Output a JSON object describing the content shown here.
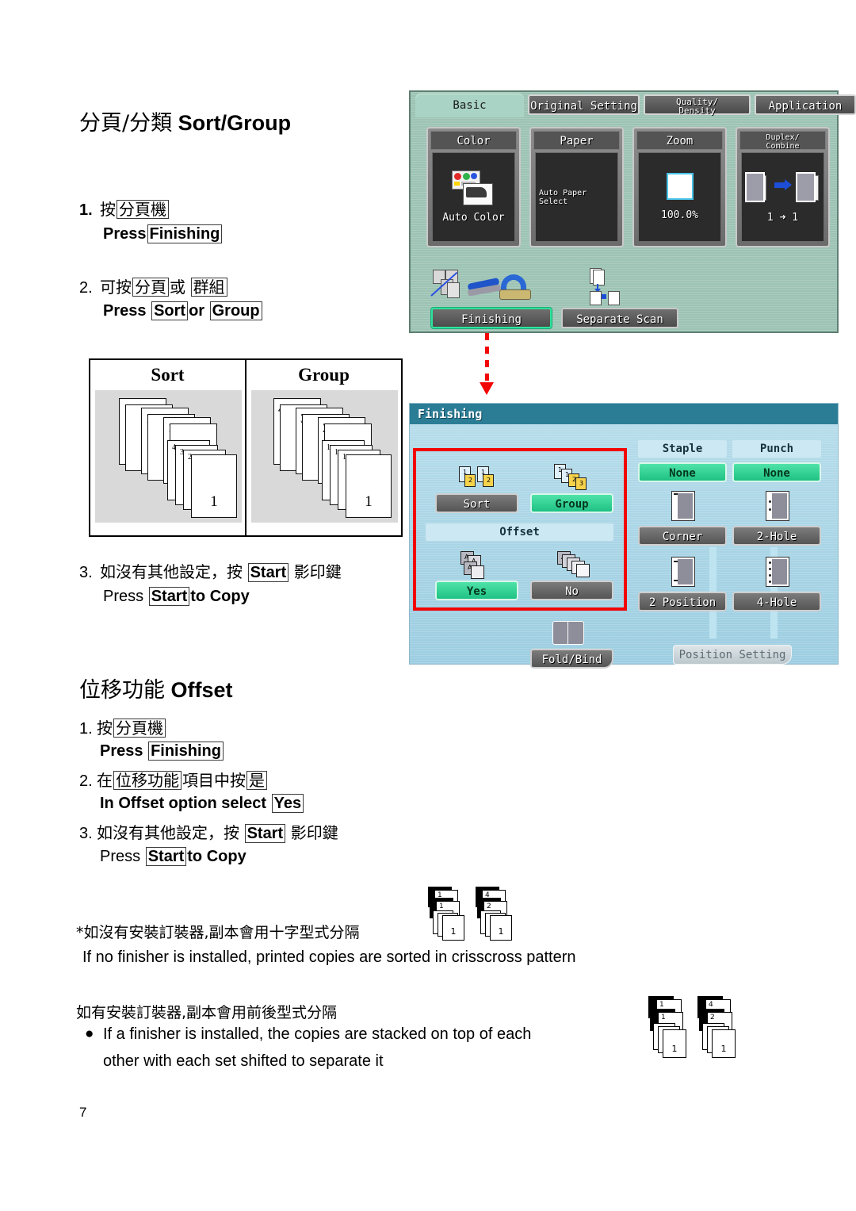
{
  "document": {
    "page_number": "7"
  },
  "section1": {
    "heading_cjk": "分頁/分類",
    "heading_en": "Sort/Group",
    "steps": [
      {
        "num": "1.",
        "cjk_prefix": "按",
        "cjk_box": "分頁機",
        "cjk_suffix": "",
        "en_prefix": "Press",
        "en_box1": "Finishing",
        "en_mid": "",
        "en_box2": "",
        "en_suffix": ""
      },
      {
        "num": "2.",
        "cjk_prefix": "可按",
        "cjk_box": "分頁",
        "cjk_mid": "或",
        "cjk_box2": "群組",
        "en_prefix": "Press",
        "en_box1": "Sort",
        "en_mid": "or",
        "en_box2": "Group",
        "en_suffix": ""
      },
      {
        "num": "3.",
        "cjk_prefix": "如沒有其他設定，按",
        "cjk_box": "Start",
        "cjk_suffix": "影印鍵",
        "en_prefix": "Press",
        "en_box1": "Start",
        "en_suffix": "to Copy"
      }
    ]
  },
  "figure": {
    "sort_caption": "Sort",
    "group_caption": "Group",
    "sort_labels_back": [
      "1",
      "1",
      "1"
    ],
    "sort_labels_front_small": [
      "4",
      "3",
      "2"
    ],
    "sort_label_front": "1",
    "group_labels_back": [
      "4",
      "3",
      "2"
    ],
    "group_labels_front_small": [
      "1",
      "1",
      "1"
    ],
    "group_label_front": "1"
  },
  "section2": {
    "heading_cjk": "位移功能",
    "heading_en": "Offset",
    "steps": [
      {
        "num": "1.",
        "cjk_prefix": "按",
        "cjk_box": "分頁機",
        "en_prefix": "Press",
        "en_box1": "Finishing"
      },
      {
        "num": "2.",
        "cjk_prefix": "在",
        "cjk_box": "位移功能",
        "cjk_mid": "項目中按",
        "cjk_box2": "是",
        "en_prefix": "In Offset option select",
        "en_box1": "Yes"
      },
      {
        "num": "3.",
        "cjk_prefix": "如沒有其他設定，按",
        "cjk_box": "Start",
        "cjk_suffix": "影印鍵",
        "en_prefix": "Press",
        "en_box1": "Start",
        "en_suffix": "to Copy"
      }
    ]
  },
  "notes": [
    {
      "cjk": "*如沒有安裝訂裝器,副本會用十字型式分隔",
      "en": "If no finisher is installed, printed copies are sorted in crisscross pattern",
      "bullet": false
    },
    {
      "cjk": "如有安裝訂裝器,副本會用前後型式分隔",
      "en_line1": "If a finisher is installed, the copies are stacked on top of each",
      "en_line2": "other with each set shifted to separate it",
      "bullet": true,
      "bullet_glyph": "●"
    }
  ],
  "panel_basic": {
    "tabs": [
      {
        "label": "Basic",
        "active": true
      },
      {
        "label": "Original Setting",
        "active": false
      },
      {
        "label_line1": "Quality/",
        "label_line2": "Density",
        "label": "Quality/Density",
        "active": false
      },
      {
        "label": "Application",
        "active": false
      }
    ],
    "buttons": [
      {
        "header": "Color",
        "value": "Auto Color",
        "icon": "color-palette-icon"
      },
      {
        "header": "Paper",
        "value_line1": "Auto Paper",
        "value_line2": "Select",
        "value": "Auto Paper Select",
        "icon": "paper-icon"
      },
      {
        "header": "Zoom",
        "value": "100.0%",
        "icon": "zoom-square-icon"
      },
      {
        "header_line1": "Duplex/",
        "header_line2": "Combine",
        "header": "Duplex/Combine",
        "value": "1 ➜ 1",
        "icon": "duplex-icon"
      }
    ],
    "function_buttons": [
      {
        "label": "Finishing",
        "selected": true,
        "icon": "stapler-punch-icon"
      },
      {
        "label": "Separate Scan",
        "selected": false,
        "icon": "separate-scan-icon"
      }
    ]
  },
  "panel_finishing": {
    "title": "Finishing",
    "sort_group": {
      "sort": {
        "label": "Sort",
        "selected": false
      },
      "group": {
        "label": "Group",
        "selected": true
      }
    },
    "offset": {
      "label": "Offset",
      "yes": {
        "label": "Yes",
        "selected": true
      },
      "no": {
        "label": "No",
        "selected": false
      }
    },
    "fold_bind": {
      "label": "Fold/Bind"
    },
    "staple": {
      "header": "Staple",
      "options": [
        {
          "label": "None",
          "selected": true
        },
        {
          "label": "Corner",
          "selected": false
        },
        {
          "label": "2 Position",
          "selected": false
        }
      ]
    },
    "punch": {
      "header": "Punch",
      "options": [
        {
          "label": "None",
          "selected": true
        },
        {
          "label": "2-Hole",
          "selected": false
        },
        {
          "label": "4-Hole",
          "selected": false
        }
      ]
    },
    "position_setting": {
      "label": "Position Setting"
    }
  },
  "colors": {
    "accent_green": "#2fe39b",
    "panel_basic_bg": "#9cc3b4",
    "panel_finishing_bg": "#a9d7e8",
    "title_bar": "#2b7d96",
    "highlight_red": "#f20505",
    "button_gray": "#6b6b6b"
  }
}
